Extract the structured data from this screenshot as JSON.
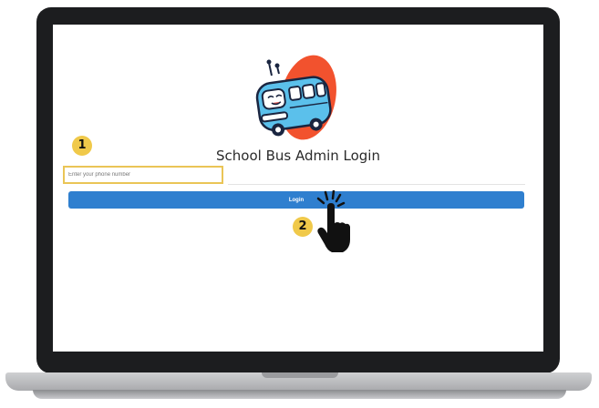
{
  "login": {
    "title": "School Bus Admin Login",
    "phone_placeholder": "Enter your phone number",
    "phone_value": "",
    "login_label": "Login"
  },
  "annotations": {
    "step_1": "1",
    "step_2": "2"
  },
  "icons": {
    "logo": "school-bus-logo",
    "pointer": "pointing-hand-icon"
  },
  "colors": {
    "login_button": "#2f7fcf",
    "highlight": "#eac556",
    "badge": "#f0c94a",
    "logo_blob": "#f2522e",
    "bus_body": "#5bc0eb"
  }
}
